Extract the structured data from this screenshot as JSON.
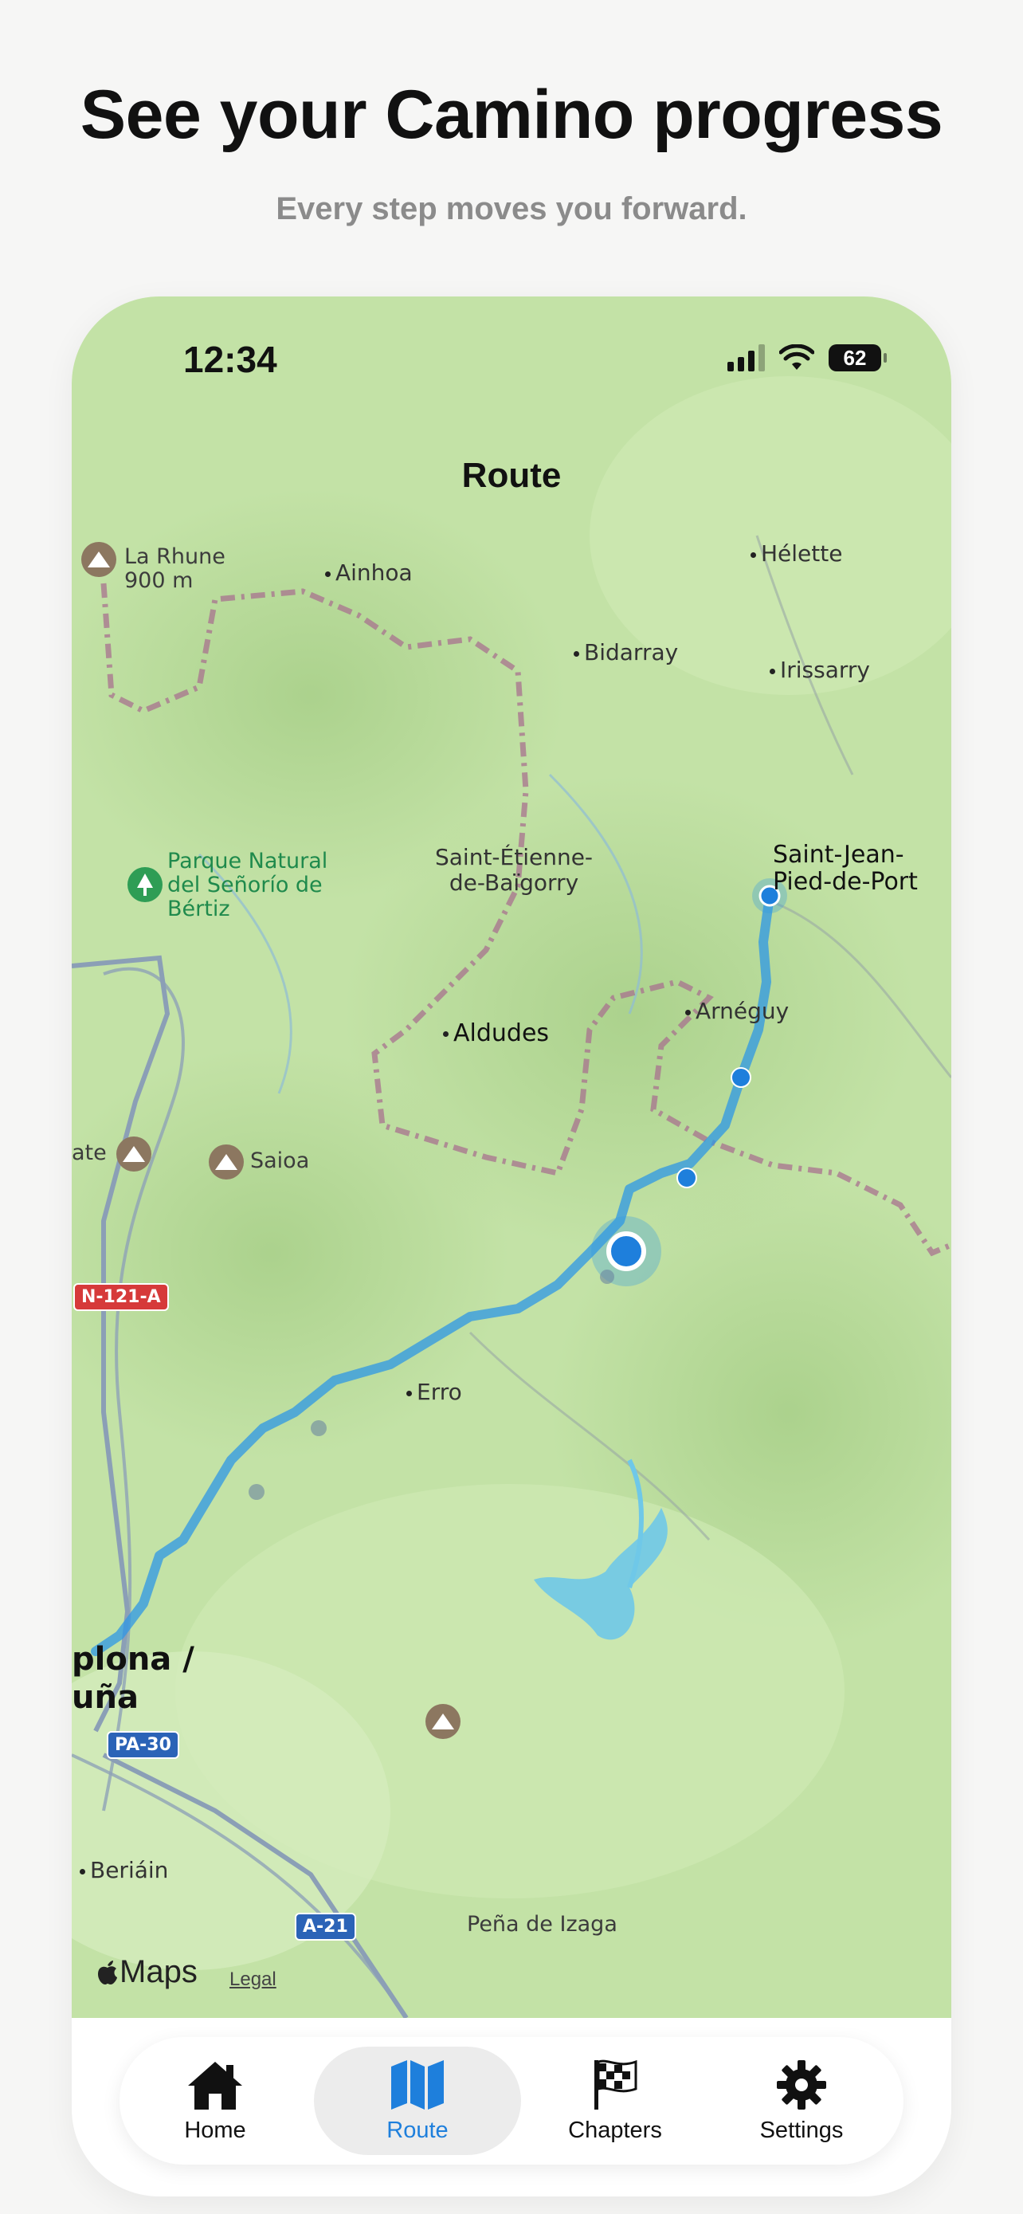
{
  "headline": "See your Camino progress",
  "subline": "Every step moves you forward.",
  "status": {
    "time": "12:34",
    "battery": "62"
  },
  "screen_title": "Route",
  "map": {
    "labels": {
      "la_rhune": "La Rhune",
      "la_rhune_elev": "900 m",
      "ainhoa": "Ainhoa",
      "helette": "Hélette",
      "bidarray": "Bidarray",
      "irissarry": "Irissarry",
      "parque1": "Parque Natural",
      "parque2": "del Señorío de",
      "parque3": "Bértiz",
      "saint_etienne1": "Saint-Étienne-",
      "saint_etienne2": "de-Baïgorry",
      "sjpp1": "Saint-Jean-",
      "sjpp2": "Pied-de-Port",
      "arneguy": "Arnéguy",
      "aldudes": "Aldudes",
      "ate": "ate",
      "saioa": "Saioa",
      "erro": "Erro",
      "pamplona1": "plona /",
      "pamplona2": "uña",
      "beriain": "Beriáin",
      "pena": "Peña de Izaga"
    },
    "roads": {
      "n121a": "N-121-A",
      "pa30": "PA-30",
      "a21": "A-21"
    },
    "brand": "Maps",
    "legal": "Legal",
    "colors": {
      "route": "#2d97e6",
      "route_light": "#7cc0f2",
      "land": "#bfe0a0",
      "border": "#a8718f",
      "water": "#6fc8e8"
    }
  },
  "tabs": [
    {
      "label": "Home",
      "icon": "house-icon"
    },
    {
      "label": "Route",
      "icon": "map-icon",
      "active": true
    },
    {
      "label": "Chapters",
      "icon": "checkered-flag-icon"
    },
    {
      "label": "Settings",
      "icon": "gear-icon"
    }
  ]
}
